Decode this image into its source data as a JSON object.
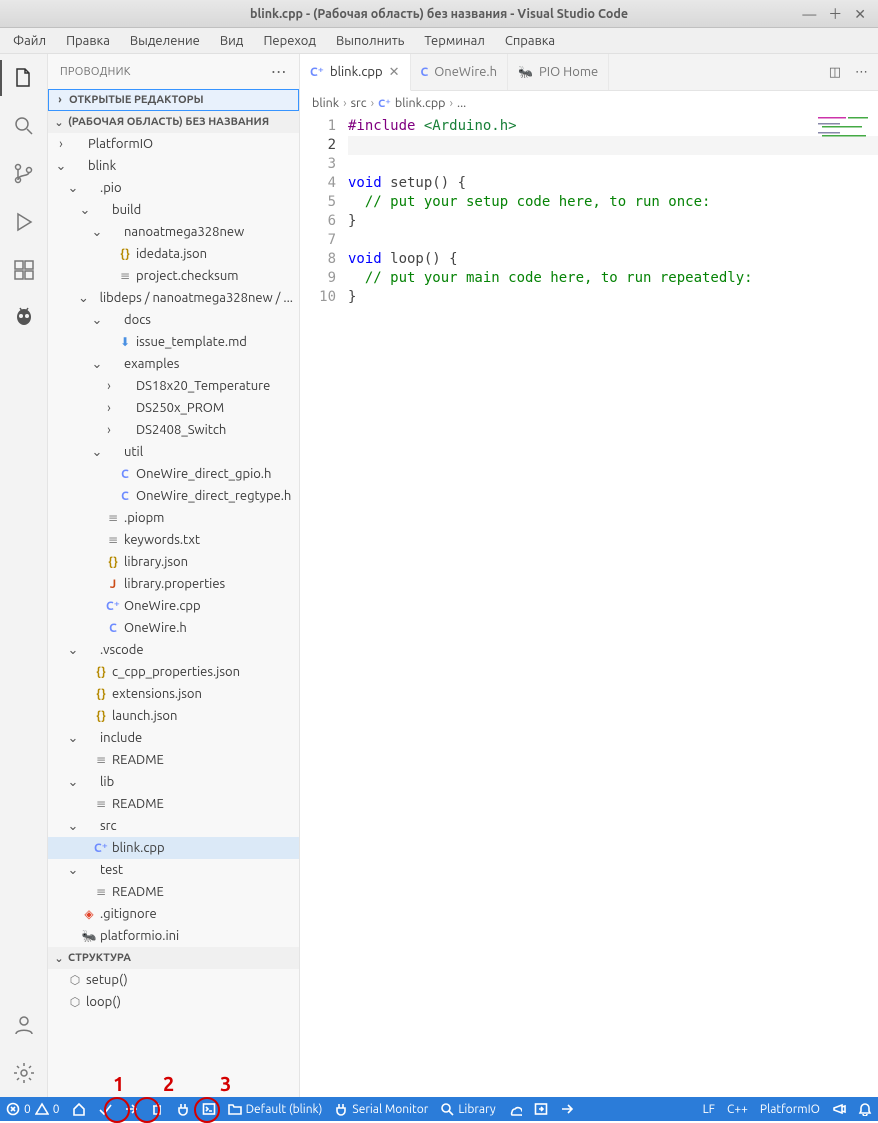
{
  "window": {
    "title": "blink.cpp - (Рабочая область) без названия - Visual Studio Code"
  },
  "menubar": [
    "Файл",
    "Правка",
    "Выделение",
    "Вид",
    "Переход",
    "Выполнить",
    "Терминал",
    "Справка"
  ],
  "sidebar": {
    "title": "ПРОВОДНИК",
    "sections": {
      "open_editors": "ОТКРЫТЫЕ РЕДАКТОРЫ",
      "workspace": "(РАБОЧАЯ ОБЛАСТЬ) БЕЗ НАЗВАНИЯ",
      "outline": "СТРУКТУРА"
    },
    "tree": [
      {
        "depth": 0,
        "twisty": "›",
        "icon": "",
        "label": "PlatformIO"
      },
      {
        "depth": 0,
        "twisty": "⌄",
        "icon": "",
        "label": "blink"
      },
      {
        "depth": 1,
        "twisty": "⌄",
        "icon": "",
        "label": ".pio"
      },
      {
        "depth": 2,
        "twisty": "⌄",
        "icon": "",
        "label": "build"
      },
      {
        "depth": 3,
        "twisty": "⌄",
        "icon": "",
        "label": "nanoatmega328new"
      },
      {
        "depth": 4,
        "twisty": "",
        "icon": "{}",
        "iconcls": "ic-json",
        "label": "idedata.json"
      },
      {
        "depth": 4,
        "twisty": "",
        "icon": "≡",
        "iconcls": "ic-file",
        "label": "project.checksum"
      },
      {
        "depth": 2,
        "twisty": "⌄",
        "icon": "",
        "label": "libdeps / nanoatmega328new / ..."
      },
      {
        "depth": 3,
        "twisty": "⌄",
        "icon": "",
        "label": "docs"
      },
      {
        "depth": 4,
        "twisty": "",
        "icon": "⬇",
        "iconcls": "ic-md",
        "label": "issue_template.md"
      },
      {
        "depth": 3,
        "twisty": "⌄",
        "icon": "",
        "label": "examples"
      },
      {
        "depth": 4,
        "twisty": "›",
        "icon": "",
        "label": "DS18x20_Temperature"
      },
      {
        "depth": 4,
        "twisty": "›",
        "icon": "",
        "label": "DS250x_PROM"
      },
      {
        "depth": 4,
        "twisty": "›",
        "icon": "",
        "label": "DS2408_Switch"
      },
      {
        "depth": 3,
        "twisty": "⌄",
        "icon": "",
        "label": "util"
      },
      {
        "depth": 4,
        "twisty": "",
        "icon": "C",
        "iconcls": "ic-c",
        "label": "OneWire_direct_gpio.h"
      },
      {
        "depth": 4,
        "twisty": "",
        "icon": "C",
        "iconcls": "ic-c",
        "label": "OneWire_direct_regtype.h"
      },
      {
        "depth": 3,
        "twisty": "",
        "icon": "≡",
        "iconcls": "ic-file",
        "label": ".piopm"
      },
      {
        "depth": 3,
        "twisty": "",
        "icon": "≡",
        "iconcls": "ic-file",
        "label": "keywords.txt"
      },
      {
        "depth": 3,
        "twisty": "",
        "icon": "{}",
        "iconcls": "ic-json",
        "label": "library.json"
      },
      {
        "depth": 3,
        "twisty": "",
        "icon": "J",
        "iconcls": "ic-j",
        "label": "library.properties"
      },
      {
        "depth": 3,
        "twisty": "",
        "icon": "C⁺",
        "iconcls": "ic-cpp",
        "label": "OneWire.cpp"
      },
      {
        "depth": 3,
        "twisty": "",
        "icon": "C",
        "iconcls": "ic-c",
        "label": "OneWire.h"
      },
      {
        "depth": 1,
        "twisty": "⌄",
        "icon": "",
        "label": ".vscode"
      },
      {
        "depth": 2,
        "twisty": "",
        "icon": "{}",
        "iconcls": "ic-json",
        "label": "c_cpp_properties.json"
      },
      {
        "depth": 2,
        "twisty": "",
        "icon": "{}",
        "iconcls": "ic-json",
        "label": "extensions.json"
      },
      {
        "depth": 2,
        "twisty": "",
        "icon": "{}",
        "iconcls": "ic-json",
        "label": "launch.json"
      },
      {
        "depth": 1,
        "twisty": "⌄",
        "icon": "",
        "label": "include"
      },
      {
        "depth": 2,
        "twisty": "",
        "icon": "≡",
        "iconcls": "ic-file",
        "label": "README"
      },
      {
        "depth": 1,
        "twisty": "⌄",
        "icon": "",
        "label": "lib"
      },
      {
        "depth": 2,
        "twisty": "",
        "icon": "≡",
        "iconcls": "ic-file",
        "label": "README"
      },
      {
        "depth": 1,
        "twisty": "⌄",
        "icon": "",
        "label": "src"
      },
      {
        "depth": 2,
        "twisty": "",
        "icon": "C⁺",
        "iconcls": "ic-cpp",
        "label": "blink.cpp",
        "selected": true
      },
      {
        "depth": 1,
        "twisty": "⌄",
        "icon": "",
        "label": "test"
      },
      {
        "depth": 2,
        "twisty": "",
        "icon": "≡",
        "iconcls": "ic-file",
        "label": "README"
      },
      {
        "depth": 1,
        "twisty": "",
        "icon": "◈",
        "iconcls": "ic-git",
        "label": ".gitignore"
      },
      {
        "depth": 1,
        "twisty": "",
        "icon": "🐜",
        "iconcls": "ic-pio",
        "label": "platformio.ini"
      }
    ],
    "outline": [
      {
        "icon": "⬡",
        "iconcls": "ic-box",
        "label": "setup()"
      },
      {
        "icon": "⬡",
        "iconcls": "ic-box",
        "label": "loop()"
      }
    ]
  },
  "tabs": [
    {
      "icon": "C⁺",
      "iconcls": "ic-cpp",
      "label": "blink.cpp",
      "active": true,
      "closable": true
    },
    {
      "icon": "C",
      "iconcls": "ic-c",
      "label": "OneWire.h",
      "active": false,
      "closable": false
    },
    {
      "icon": "🐜",
      "iconcls": "ic-pio",
      "label": "PIO Home",
      "active": false,
      "closable": false
    }
  ],
  "breadcrumb": [
    "blink",
    "src",
    "blink.cpp",
    "..."
  ],
  "code": {
    "lines": [
      "1",
      "2",
      "3",
      "4",
      "5",
      "6",
      "7",
      "8",
      "9",
      "10"
    ],
    "current": 2,
    "content": {
      "l1": {
        "pre": "#include",
        "inc": " <Arduino.h>"
      },
      "l4": {
        "kw": "void",
        "fn": " setup",
        "br": "() {"
      },
      "l5": {
        "cm": "  // put your setup code here, to run once:"
      },
      "l6": {
        "br": "}"
      },
      "l8": {
        "kw": "void",
        "fn": " loop",
        "br": "() {"
      },
      "l9": {
        "cm": "  // put your main code here, to run repeatedly:"
      },
      "l10": {
        "br": "}"
      }
    }
  },
  "status": {
    "errors": "0",
    "warnings": "0",
    "env": "Default (blink)",
    "serial": "Serial Monitor",
    "library": "Library",
    "encoding": "LF",
    "lang": "C++",
    "pio": "PlatformIO"
  },
  "annotations": {
    "a1": "1",
    "a2": "2",
    "a3": "3"
  }
}
